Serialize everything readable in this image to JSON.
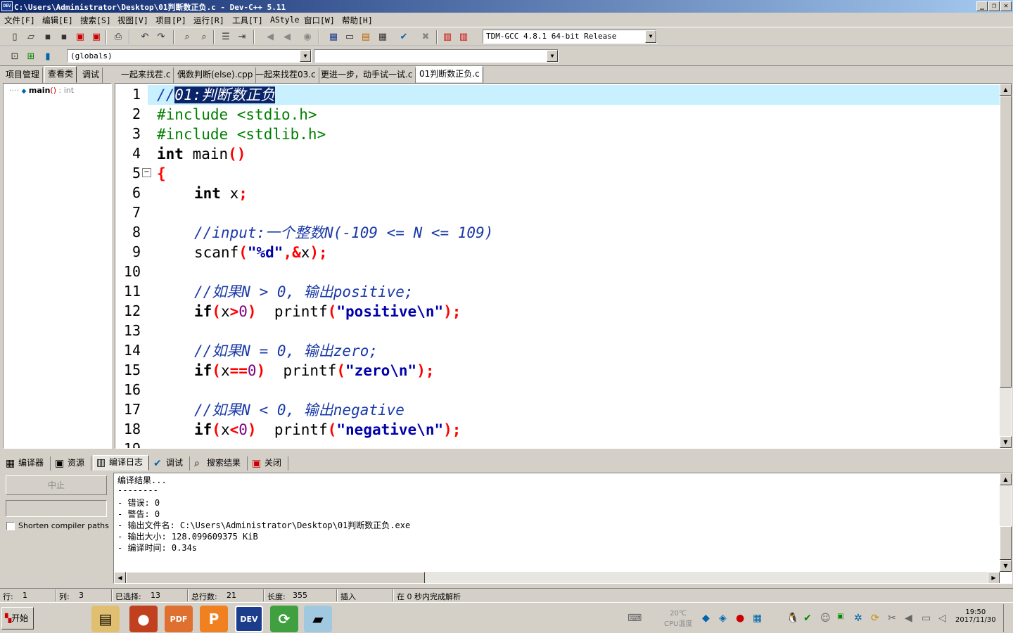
{
  "window": {
    "title": "C:\\Users\\Administrator\\Desktop\\01判断数正负.c - Dev-C++ 5.11",
    "app_icon_text": "DEV"
  },
  "menu": [
    "文件[F]",
    "编辑[E]",
    "搜索[S]",
    "视图[V]",
    "项目[P]",
    "运行[R]",
    "工具[T]",
    "AStyle",
    "窗口[W]",
    "帮助[H]"
  ],
  "toolbar": {
    "compiler_select": "TDM-GCC 4.8.1 64-bit Release",
    "scope_select": "(globals)",
    "member_select": ""
  },
  "left_tabs": [
    "项目管理",
    "查看类",
    "调试"
  ],
  "class_tree": {
    "item_name": "main",
    "item_suffix": "()",
    "item_type": ": int"
  },
  "editor_tabs": [
    "一起来找茬.c",
    "偶数判断(else).cpp",
    "一起来找茬03.c",
    "更进一步，动手试一试.c",
    "01判断数正负.c"
  ],
  "code_lines": [
    {
      "n": "1"
    },
    {
      "n": "2"
    },
    {
      "n": "3"
    },
    {
      "n": "4"
    },
    {
      "n": "5"
    },
    {
      "n": "6"
    },
    {
      "n": "7"
    },
    {
      "n": "8"
    },
    {
      "n": "9"
    },
    {
      "n": "10"
    },
    {
      "n": "11"
    },
    {
      "n": "12"
    },
    {
      "n": "13"
    },
    {
      "n": "14"
    },
    {
      "n": "15"
    },
    {
      "n": "16"
    },
    {
      "n": "17"
    },
    {
      "n": "18"
    },
    {
      "n": "19"
    }
  ],
  "code": {
    "l1_prefix": "//",
    "l1_selected": "01:判断数正负",
    "l2": "#include <stdio.h>",
    "l3": "#include <stdlib.h>",
    "l4_kw": "int",
    "l4_rest": " main",
    "l4_paren": "()",
    "l5": "{",
    "l6_kw": "int",
    "l6_rest": " x",
    "l6_semi": ";",
    "l8": "//input:一个整数N(-109 <= N <= 109)",
    "l9_fn": "scanf",
    "l9_p1": "(",
    "l9_str": "\"%d\"",
    "l9_p2": ",&",
    "l9_x": "x",
    "l9_p3": ");",
    "l11": "//如果N > 0, 输出positive;",
    "l12_kw": "if",
    "l12_p1": "(",
    "l12_x": "x",
    "l12_op": ">",
    "l12_num": "0",
    "l12_p2": ")",
    "l12_fn": "  printf",
    "l12_p3": "(",
    "l12_str": "\"positive\\n\"",
    "l12_p4": ");",
    "l14": "//如果N = 0, 输出zero;",
    "l15_kw": "if",
    "l15_p1": "(",
    "l15_x": "x",
    "l15_op": "==",
    "l15_num": "0",
    "l15_p2": ")",
    "l15_fn": "  printf",
    "l15_p3": "(",
    "l15_str": "\"zero\\n\"",
    "l15_p4": ");",
    "l17": "//如果N < 0, 输出negative",
    "l18_kw": "if",
    "l18_p1": "(",
    "l18_x": "x",
    "l18_op": "<",
    "l18_num": "0",
    "l18_p2": ")",
    "l18_fn": "  printf",
    "l18_p3": "(",
    "l18_str": "\"negative\\n\"",
    "l18_p4": ");"
  },
  "bottom_tabs": [
    "编译器",
    "资源",
    "编译日志",
    "调试",
    "搜索结果",
    "关闭"
  ],
  "bottom_left": {
    "abort_button": "中止",
    "shorten_label": "Shorten compiler paths"
  },
  "log": [
    "编译结果...",
    "--------",
    "- 错误: 0",
    "- 警告: 0",
    "- 输出文件名: C:\\Users\\Administrator\\Desktop\\01判断数正负.exe",
    "- 输出大小: 128.099609375 KiB",
    "- 编译时间: 0.34s"
  ],
  "status": {
    "row_label": "行:",
    "row": "1",
    "col_label": "列:",
    "col": "3",
    "sel_label": "已选择:",
    "sel": "13",
    "lines_label": "总行数:",
    "lines": "21",
    "len_label": "长度:",
    "len": "355",
    "mode": "插入",
    "parse": "在 0 秒内完成解析"
  },
  "taskbar": {
    "start": "开始",
    "temp": "20℃",
    "temp_label": "CPU温度",
    "time": "19:50",
    "date": "2017/11/30"
  },
  "colors": {
    "selection": "#0a246a",
    "current_line": "#c8f0ff",
    "comment": "#1a3aa8",
    "string": "#0000aa",
    "symbol": "#ff0000"
  }
}
